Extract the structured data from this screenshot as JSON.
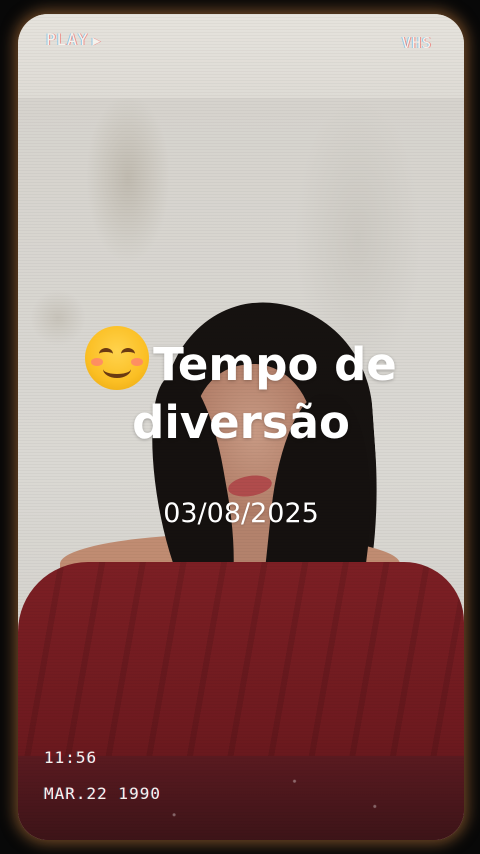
{
  "overlay": {
    "play_label": "PLAY",
    "play_icon": "play-icon",
    "format_label": "VHS",
    "time": "11:56",
    "date_stamp": "MAR.22 1990"
  },
  "title": {
    "emoji": "smiling-face-icon",
    "text": "Tempo de diversão"
  },
  "date": "03/08/2025",
  "colors": {
    "overlay_text": "#f5f2ec",
    "title_text": "#ffffff",
    "frame_glow": "#be783c"
  }
}
